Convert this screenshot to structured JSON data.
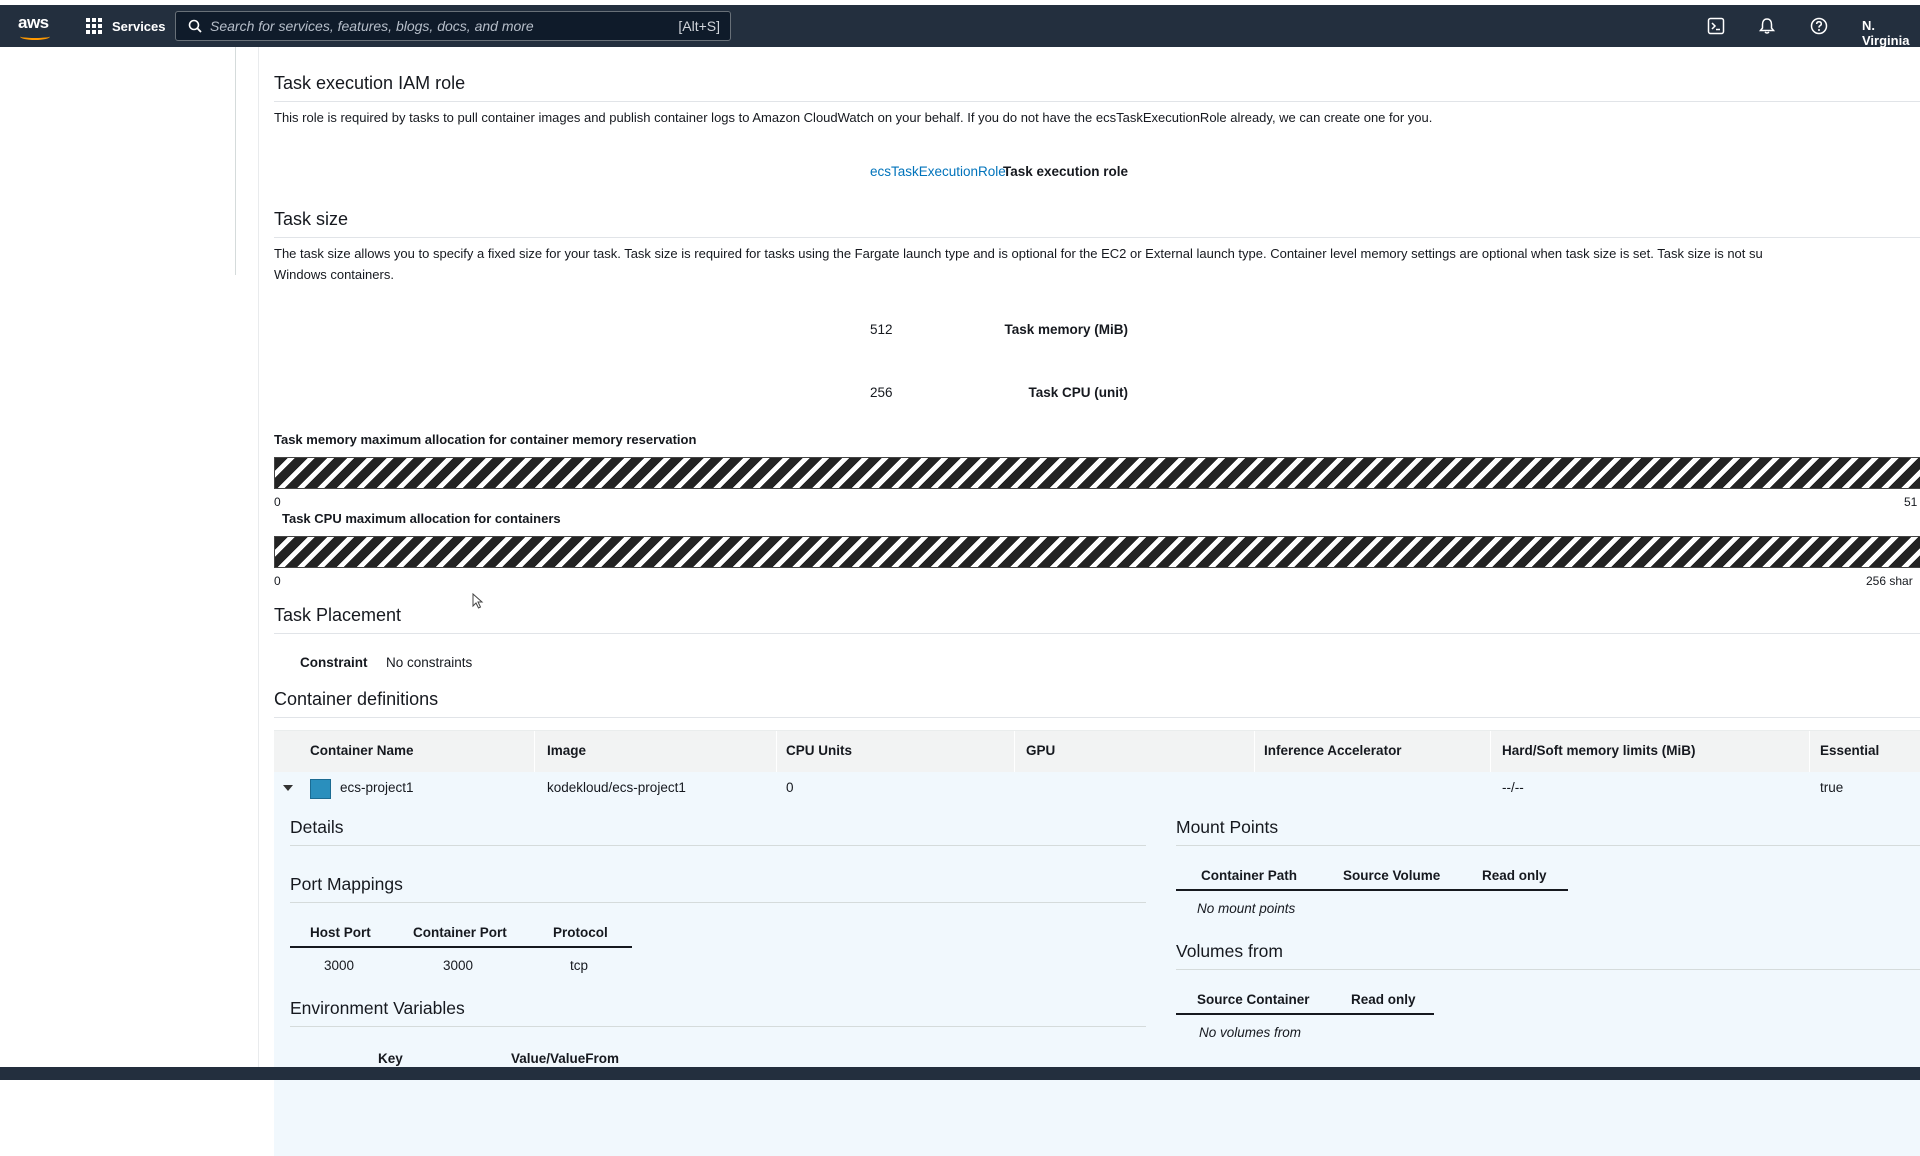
{
  "topnav": {
    "logo_text": "aws",
    "services_label": "Services",
    "search_placeholder": "Search for services, features, blogs, docs, and more",
    "search_shortcut": "[Alt+S]",
    "region": "N. Virginia",
    "icons": [
      "cloudshell-icon",
      "bell-icon",
      "help-icon"
    ]
  },
  "iam": {
    "title": "Task execution IAM role",
    "description": "This role is required by tasks to pull container images and publish container logs to Amazon CloudWatch on your behalf. If you do not have the ecsTaskExecutionRole already, we can create one for you.",
    "role_label": "Task execution role",
    "role_value": "ecsTaskExecutionRole"
  },
  "task_size": {
    "title": "Task size",
    "description_line1": "The task size allows you to specify a fixed size for your task. Task size is required for tasks using the Fargate launch type and is optional for the EC2 or External launch type. Container level memory settings are optional when task size is set. Task size is not su",
    "description_line2": "Windows containers.",
    "memory_label": "Task memory (MiB)",
    "memory_value": "512",
    "cpu_label": "Task CPU (unit)",
    "cpu_value": "256"
  },
  "allocation": {
    "memory_title": "Task memory maximum allocation for container memory reservation",
    "memory_min": "0",
    "memory_max": "51",
    "cpu_title": "Task CPU maximum allocation for containers",
    "cpu_min": "0",
    "cpu_max": "256 shar"
  },
  "placement": {
    "title": "Task Placement",
    "constraint_label": "Constraint",
    "constraint_value": "No constraints"
  },
  "containers": {
    "title": "Container definitions",
    "headers": [
      "Container Name",
      "Image",
      "CPU Units",
      "GPU",
      "Inference Accelerator",
      "Hard/Soft memory limits (MiB)",
      "Essential"
    ],
    "rows": [
      {
        "name": "ecs-project1",
        "image": "kodekloud/ecs-project1",
        "cpu": "0",
        "gpu": "",
        "accelerator": "",
        "memory": "--/--",
        "essential": "true"
      }
    ]
  },
  "details": {
    "title": "Details",
    "port_mappings": {
      "title": "Port Mappings",
      "headers": [
        "Host Port",
        "Container Port",
        "Protocol"
      ],
      "rows": [
        [
          "3000",
          "3000",
          "tcp"
        ]
      ]
    },
    "env": {
      "title": "Environment Variables",
      "headers": [
        "Key",
        "Value/ValueFrom"
      ]
    },
    "mount_points": {
      "title": "Mount Points",
      "headers": [
        "Container Path",
        "Source Volume",
        "Read only"
      ],
      "empty": "No mount points"
    },
    "volumes_from": {
      "title": "Volumes from",
      "headers": [
        "Source Container",
        "Read only"
      ],
      "empty": "No volumes from"
    }
  },
  "colors": {
    "nav_bg": "#232f3e",
    "link": "#0073bb",
    "accent": "#ff9900",
    "row_highlight": "#f1f8fd"
  }
}
